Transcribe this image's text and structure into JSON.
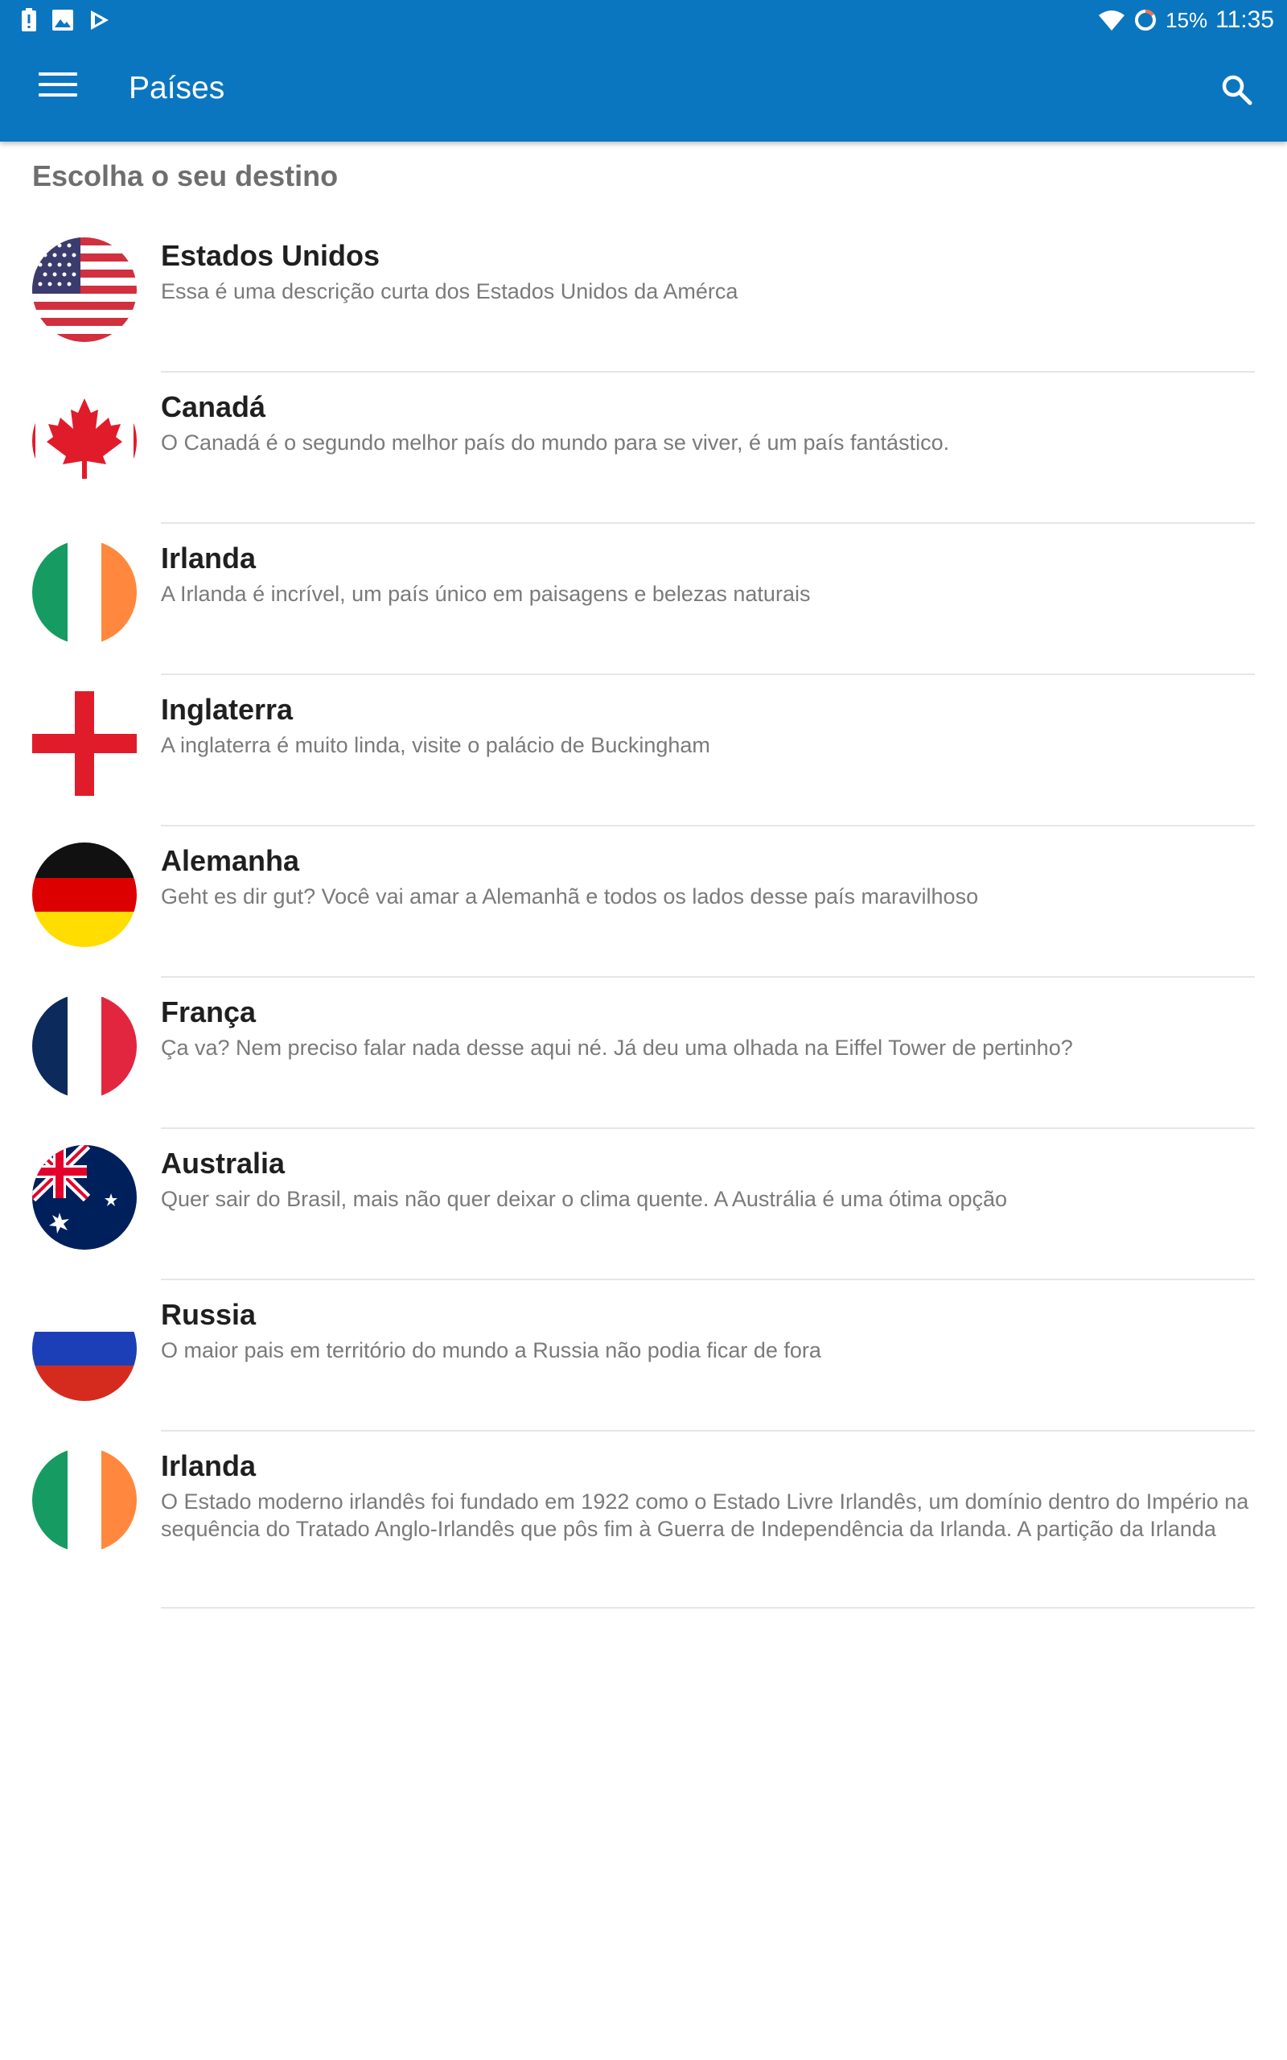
{
  "statusbar": {
    "battery_percent": "15%",
    "time": "11:35"
  },
  "appbar": {
    "title": "Países"
  },
  "subheader": "Escolha o seu destino",
  "countries": [
    {
      "name": "Estados Unidos",
      "description": "Essa é uma descrição curta dos Estados Unidos da Amérca",
      "flag_icon": "usa-flag-icon"
    },
    {
      "name": "Canadá",
      "description": "O Canadá é o segundo melhor país do mundo para se viver, é um país fantástico.",
      "flag_icon": "canada-flag-icon"
    },
    {
      "name": "Irlanda",
      "description": "A Irlanda é incrível, um país único em paisagens e belezas naturais",
      "flag_icon": "ireland-flag-icon"
    },
    {
      "name": "Inglaterra",
      "description": "A inglaterra é muito linda, visite o palácio de Buckingham",
      "flag_icon": "england-flag-icon"
    },
    {
      "name": "Alemanha",
      "description": "Geht es dir gut? Você vai amar a Alemanhã e todos os lados desse país maravilhoso",
      "flag_icon": "germany-flag-icon"
    },
    {
      "name": "França",
      "description": "Ça va? Nem preciso falar nada desse aqui né. Já deu uma olhada na Eiffel Tower de pertinho?",
      "flag_icon": "france-flag-icon"
    },
    {
      "name": "Australia",
      "description": "Quer sair do Brasil, mais não quer deixar o clima quente. A Austrália é uma ótima opção",
      "flag_icon": "australia-flag-icon"
    },
    {
      "name": "Russia",
      "description": "O maior pais em território do mundo a Russia não podia ficar de fora",
      "flag_icon": "russia-flag-icon"
    },
    {
      "name": "Irlanda",
      "description": "O Estado moderno irlandês foi fundado em 1922 como o Estado Livre Irlandês, um domínio dentro do Império na sequência do Tratado Anglo-Irlandês que pôs fim à Guerra de Independência da Irlanda. A partição da Irlanda",
      "flag_icon": "ireland-flag-icon"
    }
  ],
  "colors": {
    "primary": "#0b76c0",
    "title_text": "#1f1f1f",
    "secondary_text": "#7a7a7a",
    "subheader_text": "#6e6e6e"
  }
}
